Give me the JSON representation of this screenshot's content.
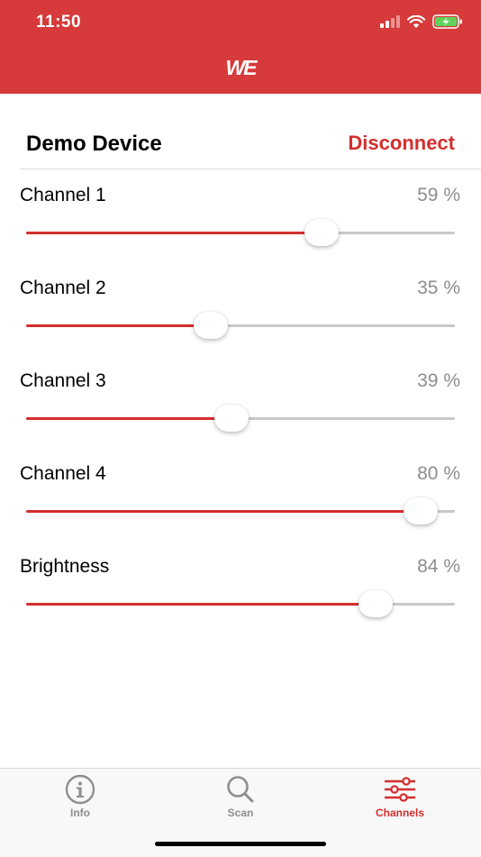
{
  "status_bar": {
    "time": "11:50"
  },
  "header": {
    "logo_text": "WE",
    "color": "#d63a3a"
  },
  "device": {
    "name": "Demo Device",
    "disconnect_label": "Disconnect"
  },
  "channels": [
    {
      "label": "Channel 1",
      "value_text": "59 %",
      "level": 0.69
    },
    {
      "label": "Channel 2",
      "value_text": "35 %",
      "level": 0.43
    },
    {
      "label": "Channel 3",
      "value_text": "39 %",
      "level": 0.48
    },
    {
      "label": "Channel 4",
      "value_text": "80 %",
      "level": 0.92
    },
    {
      "label": "Brightness",
      "value_text": "84 %",
      "level": 0.815
    }
  ],
  "tabs": [
    {
      "label": "Info",
      "icon": "info-icon",
      "active": false
    },
    {
      "label": "Scan",
      "icon": "search-icon",
      "active": false
    },
    {
      "label": "Channels",
      "icon": "sliders-icon",
      "active": true
    }
  ],
  "colors": {
    "accent": "#d42e2e",
    "track": "#c9c9c9",
    "inactive_tab": "#8e8e8e"
  }
}
